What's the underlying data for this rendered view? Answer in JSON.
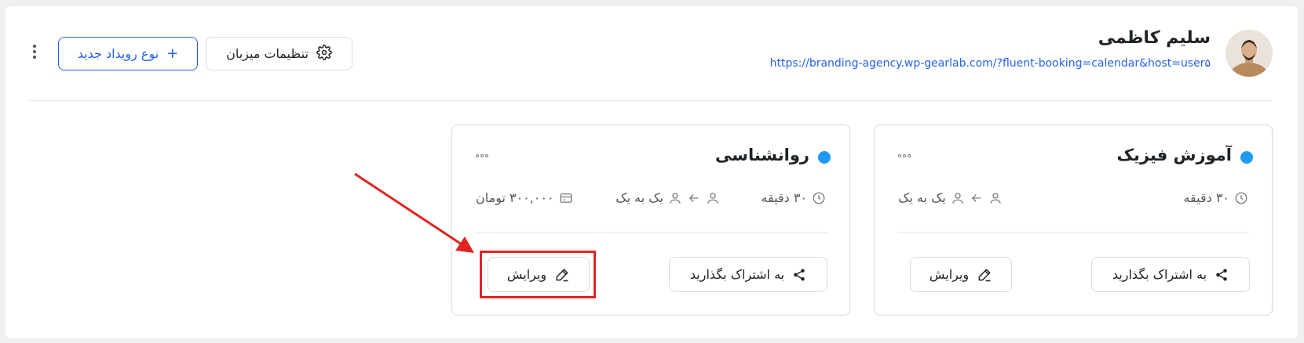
{
  "header": {
    "host_name": "سلیم کاظمی",
    "host_url": "https://branding-agency.wp-gearlab.com/?fluent-booking=calendar&host=user۵",
    "settings_label": "تنظیمات میزبان",
    "new_event_type_label": "نوع رویداد جدید",
    "new_event_type_plus": "+",
    "avatar_icon": "avatar"
  },
  "cards": [
    {
      "title": "آموزش فیزیک",
      "status_color": "#1e9bf0",
      "duration": "۳۰ دقیقه",
      "type_label": "یک به یک",
      "share_label": "به اشتراک بگذارید",
      "edit_label": "ویرایش"
    },
    {
      "title": "روانشناسی",
      "status_color": "#1e9bf0",
      "duration": "۳۰ دقیقه",
      "type_label": "یک به یک",
      "price": "۳۰۰,۰۰۰ تومان",
      "share_label": "به اشتراک بگذارید",
      "edit_label": "ویرایش"
    }
  ],
  "annotation": {
    "color": "#e02424",
    "target": "edit button of second card"
  },
  "colors": {
    "accent": "#2563eb",
    "dot": "#1e9bf0",
    "border": "#d7dbe0"
  }
}
